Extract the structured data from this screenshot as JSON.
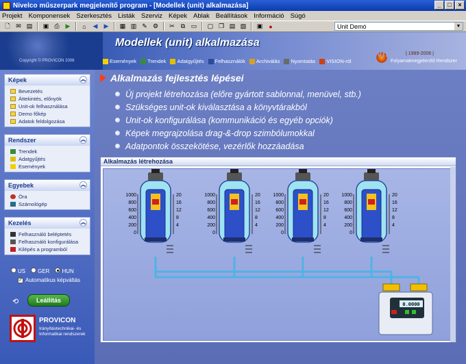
{
  "window": {
    "title": "Nivelco műszerpark megjelenítő program - [Modellek (unit) alkalmazása]"
  },
  "menu": [
    "Projekt",
    "Komponensek",
    "Szerkesztés",
    "Listák",
    "Szerviz",
    "Képek",
    "Ablak",
    "Beállítások",
    "Információ",
    "Súgó"
  ],
  "toolbar": {
    "unit_select": "Unit Demó"
  },
  "banner": {
    "title": "Modellek (unit) alkalmazása",
    "copyright": "Copyright © PROVICON 2006",
    "vision": "VISION",
    "vision_years": "| 1989-2006 |",
    "vision_sub": "Folyamatmegjelenítő Rendszer",
    "nav": [
      "Események",
      "Trendek",
      "Adatgyűjtés",
      "Felhasználók",
      "Archiválás",
      "Nyomtatás",
      "VISION-ról"
    ]
  },
  "sidebar": {
    "panels": [
      {
        "title": "Képek",
        "items": [
          "Bevezetés",
          "Áttekintés, előnyök",
          "Unit-ok felhasználása",
          "Demo főkép",
          "Adatok feldolgozása"
        ]
      },
      {
        "title": "Rendszer",
        "items": [
          "Trendek",
          "Adatgyűjtés",
          "Események"
        ]
      },
      {
        "title": "Egyebek",
        "items": [
          "Óra",
          "Számológép"
        ]
      },
      {
        "title": "Kezelés",
        "items": [
          "Felhasználó beléptetés",
          "Felhasználó konfigurálása",
          "Kilépés a programból"
        ]
      }
    ],
    "languages": [
      "US",
      "GER",
      "HUN"
    ],
    "language_selected": "HUN",
    "auto_label": "Automatikus képváltás",
    "stop_label": "Leállítás",
    "company": "PROVICON",
    "company_sub1": "Irányítástechnikai- és",
    "company_sub2": "Informatikai rendszerek"
  },
  "main": {
    "heading": "Alkalmazás fejlesztés lépései",
    "bullets": [
      "Új projekt létrehozása (előre gyártott sablonnal, menüvel, stb.)",
      "Szükséges unit-ok kiválasztása a könyvtárakból",
      "Unit-ok konfigurálása (kommunikáció és egyéb opciók)",
      "Képek megrajzolása drag-&-drop szimbólumokkal",
      "Adatpontok összekötése, vezérlők hozzáadása"
    ],
    "dialog_title": "Alkalmazás létrehozása",
    "gauge_left_ticks": [
      "1000",
      "800",
      "600",
      "400",
      "200",
      "0"
    ],
    "gauge_right_ticks": [
      "20",
      "16",
      "12",
      "8",
      "4"
    ],
    "display_value": "0.0000"
  }
}
